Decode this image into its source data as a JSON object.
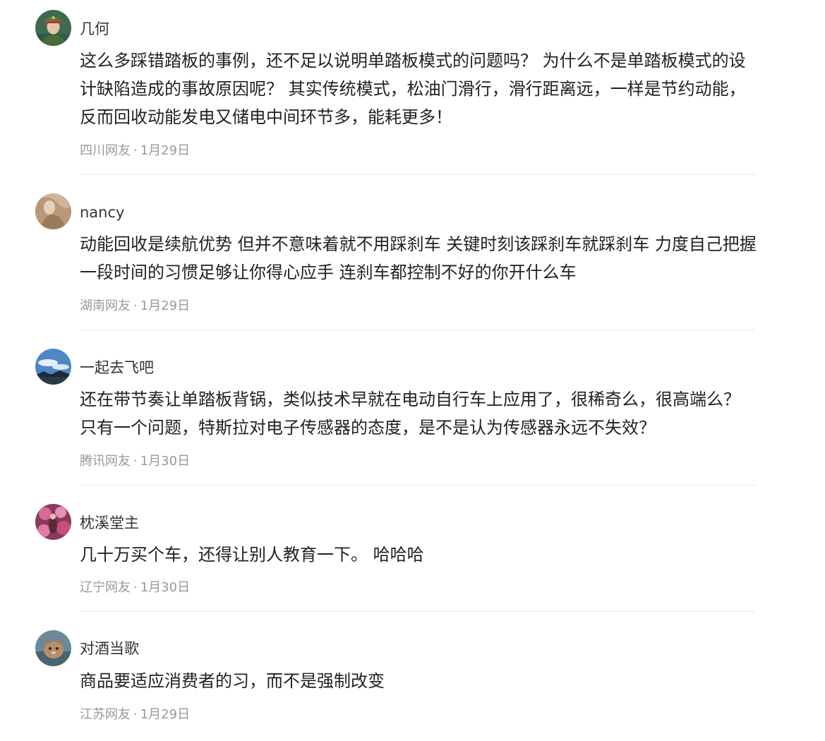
{
  "comments": [
    {
      "username": "几何",
      "avatar_icon": "avatar-soldier-portrait",
      "content": "这么多踩错踏板的事例，还不足以说明单踏板模式的问题吗？ 为什么不是单踏板模式的设计缺陷造成的事故原因呢？ 其实传统模式，松油门滑行，滑行距离远，一样是节约动能，反而回收动能发电又储电中间环节多，能耗更多！",
      "location": "四川网友",
      "separator": "·",
      "date": "1月29日"
    },
    {
      "username": "nancy",
      "avatar_icon": "avatar-beige-abstract",
      "content": "动能回收是续航优势 但并不意味着就不用踩刹车 关键时刻该踩刹车就踩刹车 力度自己把握 一段时间的习惯足够让你得心应手 连刹车都控制不好的你开什么车",
      "location": "湖南网友",
      "separator": "·",
      "date": "1月29日"
    },
    {
      "username": "一起去飞吧",
      "avatar_icon": "avatar-sky-landscape",
      "content": "还在带节奏让单踏板背锅，类似技术早就在电动自行车上应用了，很稀奇么，很高端么？ 只有一个问题，特斯拉对电子传感器的态度，是不是认为传感器永远不失效？",
      "location": "腾讯网友",
      "separator": "·",
      "date": "1月30日"
    },
    {
      "username": "枕溪堂主",
      "avatar_icon": "avatar-pink-blossom",
      "content": "几十万买个车，还得让别人教育一下。 哈哈哈",
      "location": "辽宁网友",
      "separator": "·",
      "date": "1月30日"
    },
    {
      "username": "对酒当歌",
      "avatar_icon": "avatar-cat-photo",
      "content": "商品要适应消费者的习，而不是强制改变",
      "location": "江苏网友",
      "separator": "·",
      "date": "1月29日"
    }
  ]
}
